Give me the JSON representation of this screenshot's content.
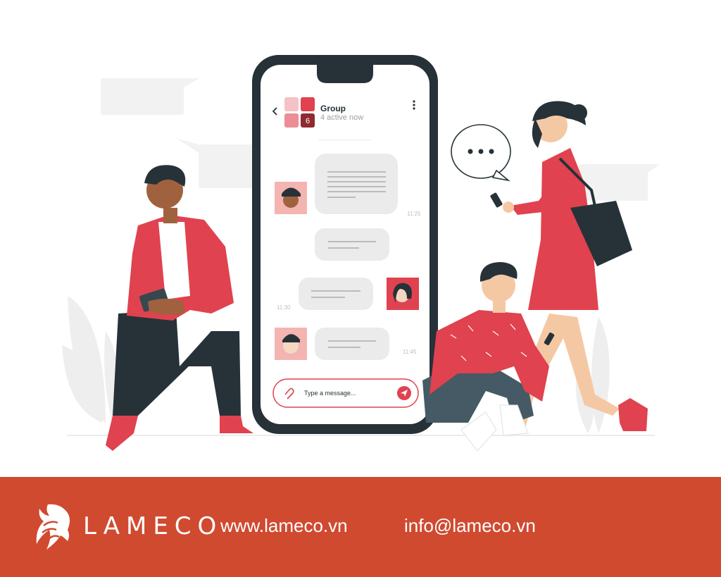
{
  "chat": {
    "group_name": "Group",
    "status": "4 active now",
    "badge_count": "6",
    "times": [
      "11:25",
      "11:30",
      "11:45"
    ],
    "input_placeholder": "Type a message..."
  },
  "footer": {
    "brand": "LAMECO",
    "website": "www.lameco.vn",
    "email": "info@lameco.vn"
  },
  "colors": {
    "accent": "#e0424f",
    "footer_bg": "#d04a30",
    "dark": "#263238"
  }
}
